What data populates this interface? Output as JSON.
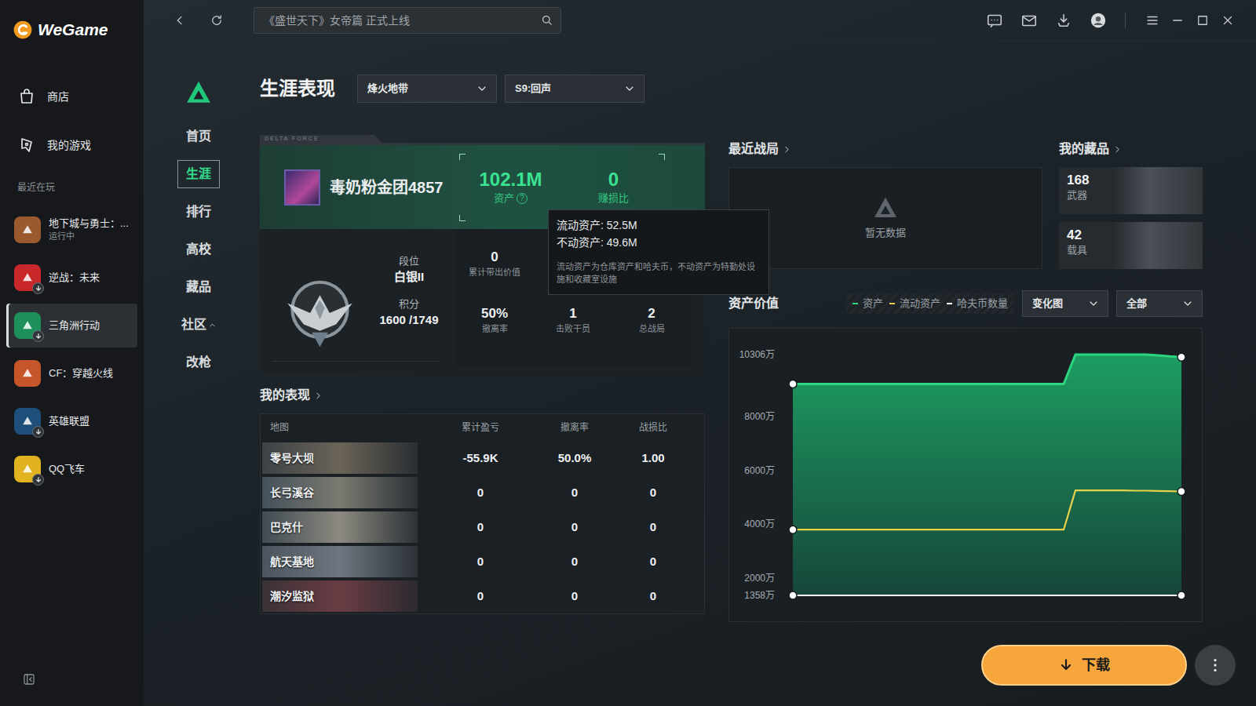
{
  "app": {
    "logo": "WeGame"
  },
  "sidebar": {
    "items": [
      {
        "label": "商店",
        "selected": false
      },
      {
        "label": "我的游戏",
        "selected": false
      }
    ],
    "recent_label": "最近在玩",
    "games": [
      {
        "name": "地下城与勇士：...",
        "status": "运行中",
        "selected": false,
        "download": false,
        "color": "#9a5a2e"
      },
      {
        "name": "逆战：未来",
        "selected": false,
        "download": true,
        "color": "#c9282b"
      },
      {
        "name": "三角洲行动",
        "selected": true,
        "download": true,
        "color": "#1c8f5a"
      },
      {
        "name": "CF：穿越火线",
        "selected": false,
        "download": false,
        "color": "#c7552a"
      },
      {
        "name": "英雄联盟",
        "selected": false,
        "download": true,
        "color": "#1d4f7a"
      },
      {
        "name": "QQ飞车",
        "selected": false,
        "download": true,
        "color": "#e2b321"
      }
    ]
  },
  "topbar": {
    "search_placeholder": "《盛世天下》女帝篇 正式上线"
  },
  "subnav": {
    "items": [
      {
        "label": "首页",
        "selected": false
      },
      {
        "label": "生涯",
        "selected": true
      },
      {
        "label": "排行",
        "selected": false
      },
      {
        "label": "高校",
        "selected": false
      },
      {
        "label": "藏品",
        "selected": false
      },
      {
        "label": "社区",
        "selected": false,
        "expanded": true
      },
      {
        "label": "改枪",
        "selected": false
      }
    ]
  },
  "page": {
    "title": "生涯表现",
    "mode": "烽火地带",
    "season": "S9:回声"
  },
  "profile": {
    "strip": "DELTA FORCE",
    "name": "毒奶粉金团4857",
    "assets": {
      "value": "102.1M",
      "label": "资产",
      "help": "?"
    },
    "ratio": {
      "value": "0",
      "label": "赚损比"
    },
    "rank": {
      "label": "段位",
      "value": "白银II",
      "score_label": "积分",
      "score": "1600 /1749"
    },
    "stats": [
      {
        "value": "0",
        "label": "累计带出价值"
      },
      {
        "value": "50%",
        "label": "撤离率"
      },
      {
        "value": "1",
        "label": "击败干员"
      },
      {
        "value": "2",
        "label": "总战局"
      }
    ]
  },
  "tooltip": {
    "lines": [
      "流动资产: 52.5M",
      "不动资产: 49.6M"
    ],
    "note": "流动资产为仓库资产和哈夫币，不动资产为特勤处设施和收藏室设施"
  },
  "performance": {
    "title": "我的表现",
    "columns": [
      "地图",
      "累计盈亏",
      "撤离率",
      "战损比"
    ],
    "rows": [
      [
        "零号大坝",
        "-55.9K",
        "50.0%",
        "1.00"
      ],
      [
        "长弓溪谷",
        "0",
        "0",
        "0"
      ],
      [
        "巴克什",
        "0",
        "0",
        "0"
      ],
      [
        "航天基地",
        "0",
        "0",
        "0"
      ],
      [
        "潮汐监狱",
        "0",
        "0",
        "0"
      ]
    ]
  },
  "recent_battles": {
    "title": "最近战局",
    "empty": "暂无数据"
  },
  "collection": {
    "title": "我的藏品",
    "items": [
      {
        "count": "168",
        "label": "武器"
      },
      {
        "count": "42",
        "label": "载具"
      }
    ]
  },
  "chart": {
    "title": "资产价值",
    "view": "变化图",
    "range": "全部",
    "ticks": [
      {
        "label": "10306万",
        "value": 10306
      },
      {
        "label": "8000万",
        "value": 8000
      },
      {
        "label": "6000万",
        "value": 6000
      },
      {
        "label": "4000万",
        "value": 4000
      },
      {
        "label": "2000万",
        "value": 2000
      },
      {
        "label": "1358万",
        "value": 1358
      }
    ],
    "series": [
      {
        "label": "资产",
        "color": "#2bd67f",
        "values": [
          9211,
          9211,
          9211,
          9211,
          9211,
          9211,
          9211,
          9211,
          9211,
          9211,
          9211,
          9211,
          9211,
          9211,
          9211,
          9211,
          9211,
          9211,
          9211,
          9211,
          9211,
          9211,
          9211,
          9211,
          10306,
          10306,
          10306,
          10306,
          10306,
          10306,
          10306,
          10280,
          10240,
          10210
        ]
      },
      {
        "label": "流动资产",
        "color": "#e5d24a",
        "values": [
          3800,
          3800,
          3800,
          3800,
          3800,
          3800,
          3800,
          3800,
          3800,
          3800,
          3800,
          3800,
          3800,
          3800,
          3800,
          3800,
          3800,
          3800,
          3800,
          3800,
          3800,
          3800,
          3800,
          3800,
          5260,
          5260,
          5260,
          5260,
          5260,
          5250,
          5250,
          5240,
          5230,
          5220
        ]
      },
      {
        "label": "哈夫币数量",
        "color": "#ffffff",
        "values": [
          1358,
          1358,
          1358,
          1358,
          1358,
          1358,
          1358,
          1358,
          1358,
          1358,
          1358,
          1358,
          1358,
          1358,
          1358,
          1358,
          1358,
          1358,
          1358,
          1358,
          1358,
          1358,
          1358,
          1358,
          1358,
          1358,
          1358,
          1358,
          1358,
          1358,
          1358,
          1358,
          1358,
          1358
        ]
      }
    ]
  },
  "download": {
    "label": "下载"
  }
}
